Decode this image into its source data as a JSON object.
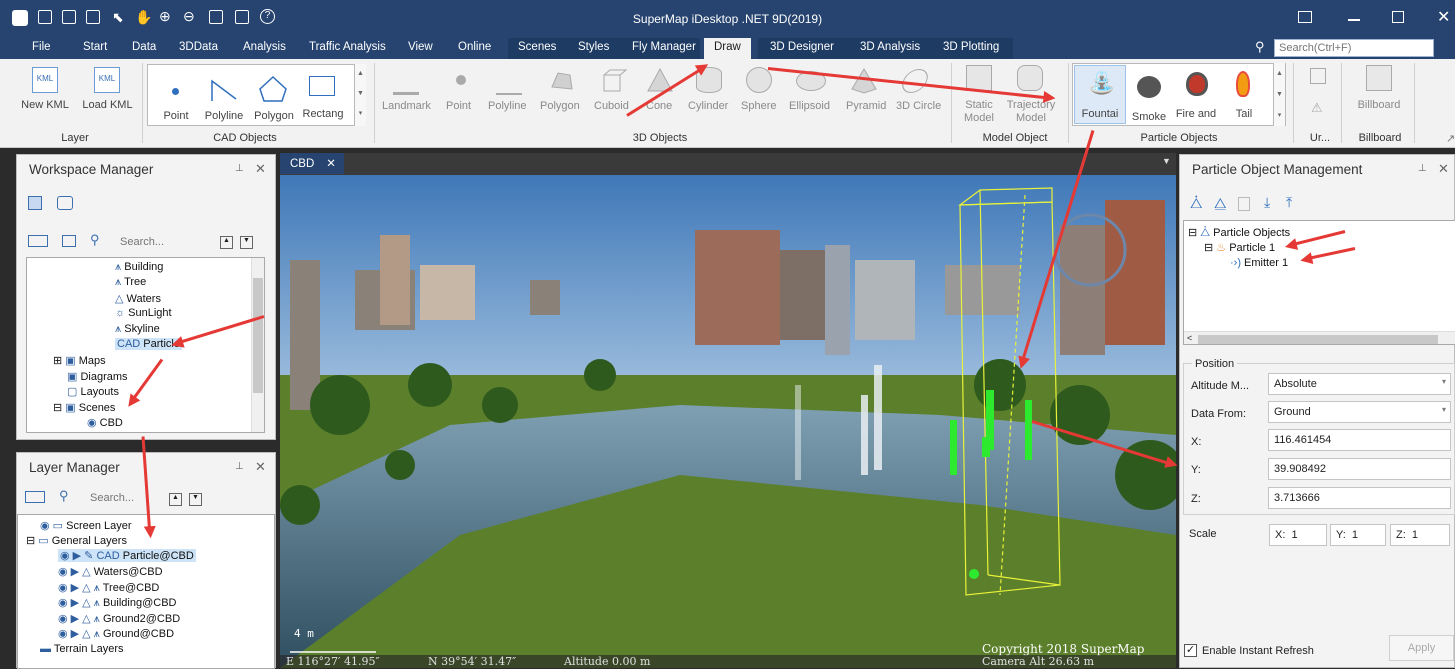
{
  "app": {
    "title": "SuperMap iDesktop .NET 9D(2019)"
  },
  "search": {
    "placeholder": "Search(Ctrl+F)"
  },
  "menu": {
    "items": [
      "File",
      "Start",
      "Data",
      "3DData",
      "Analysis",
      "Traffic Analysis",
      "View",
      "Online",
      "Scenes",
      "Styles",
      "Fly Manager",
      "Draw",
      "3D Designer",
      "3D Analysis",
      "3D Plotting"
    ],
    "active": "Draw"
  },
  "ribbon": {
    "layer": {
      "new_kml": "New KML",
      "load_kml": "Load KML",
      "label": "Layer"
    },
    "cad": {
      "items": [
        "Point",
        "Polyline",
        "Polygon",
        "Rectang"
      ],
      "label": "CAD Objects"
    },
    "objects3d": {
      "items": [
        "Landmark",
        "Point",
        "Polyline",
        "Polygon",
        "Cuboid",
        "Cone",
        "Cylinder",
        "Sphere",
        "Ellipsoid",
        "Pyramid",
        "3D Circle"
      ],
      "label": "3D Objects"
    },
    "model": {
      "static1": "Static",
      "static2": "Model",
      "traj1": "Trajectory",
      "traj2": "Model",
      "label": "Model Object"
    },
    "particle": {
      "items": [
        "Fountai",
        "Smoke",
        "Fire and",
        "Tail"
      ],
      "label": "Particle Objects"
    },
    "ur": {
      "label": "Ur..."
    },
    "billboard": {
      "item": "Billboard",
      "label": "Billboard"
    }
  },
  "workspace": {
    "title": "Workspace Manager",
    "search_placeholder": "Search...",
    "items": [
      "Building",
      "Tree",
      "Waters",
      "SunLight",
      "Skyline",
      "Particle",
      "Maps",
      "Diagrams",
      "Layouts",
      "Scenes",
      "CBD"
    ],
    "selected": "Particle"
  },
  "layers": {
    "title": "Layer Manager",
    "search_placeholder": "Search...",
    "items": [
      "Screen Layer",
      "General Layers",
      "Particle@CBD",
      "Waters@CBD",
      "Tree@CBD",
      "Building@CBD",
      "Ground2@CBD",
      "Ground@CBD",
      "Terrain Layers"
    ]
  },
  "scene": {
    "tab": "CBD",
    "scale": "4 m",
    "copyright": "Copyright 2018 SuperMap",
    "camera_alt": "Camera Alt  26.63 m",
    "lon": "E  116°27′ 41.95″",
    "lat": "N  39°54′ 31.47″",
    "altitude": "Altitude  0.00 m"
  },
  "particle_panel": {
    "title": "Particle Object Management",
    "tree": [
      "Particle Objects",
      "Particle 1",
      "Emitter 1"
    ],
    "position_label": "Position",
    "altitude_mode_label": "Altitude M...",
    "altitude_mode": "Absolute",
    "data_from_label": "Data From:",
    "data_from": "Ground",
    "x_label": "X:",
    "x": "116.461454",
    "y_label": "Y:",
    "y": "39.908492",
    "z_label": "Z:",
    "z": "3.713666",
    "scale_label": "Scale",
    "scale_x_label": "X:",
    "scale_x": "1",
    "scale_y_label": "Y:",
    "scale_y": "1",
    "scale_z_label": "Z:",
    "scale_z": "1",
    "refresh_label": "Enable Instant Refresh",
    "apply": "Apply"
  },
  "colors": {
    "title_bg": "#26446f",
    "annotation": "#e53935",
    "selection": "#cde3f7"
  }
}
